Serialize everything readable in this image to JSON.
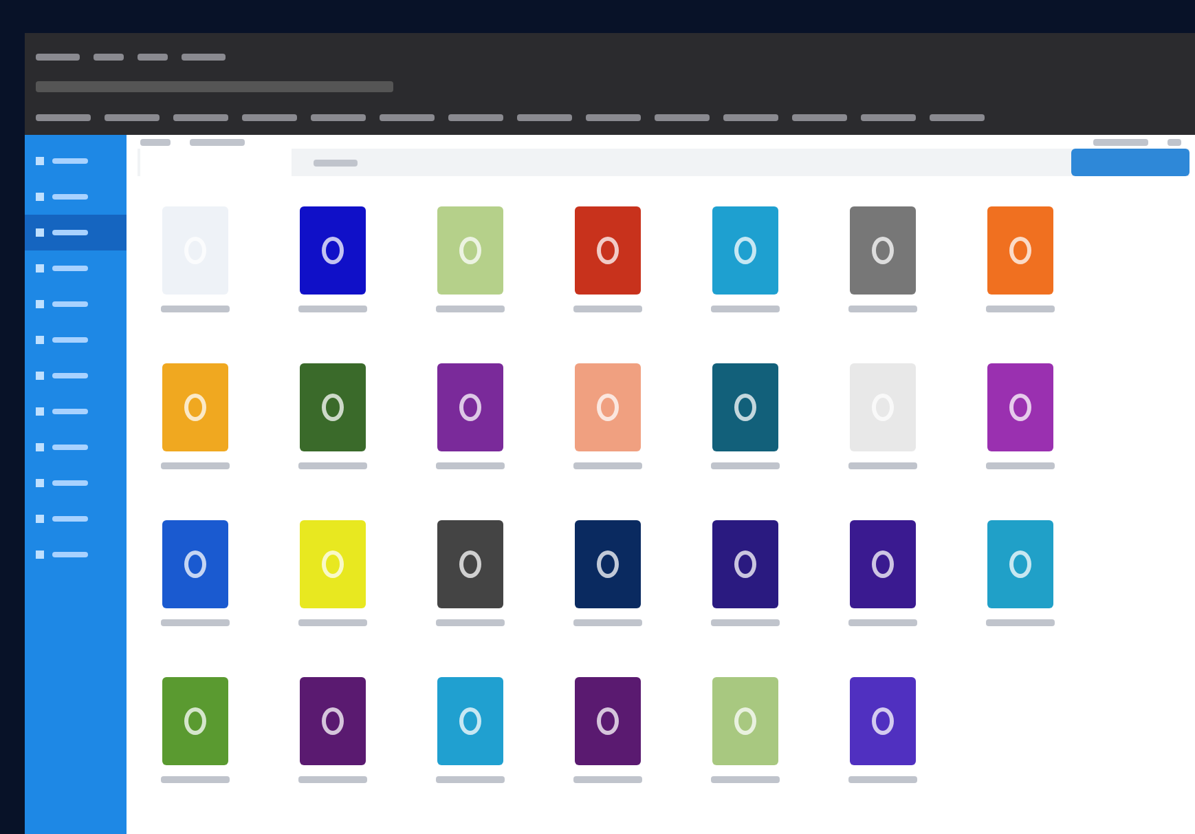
{
  "sidebar": {
    "items": [
      {
        "selected": false
      },
      {
        "selected": false
      },
      {
        "selected": true
      },
      {
        "selected": false
      },
      {
        "selected": false
      },
      {
        "selected": false
      },
      {
        "selected": false
      },
      {
        "selected": false
      },
      {
        "selected": false
      },
      {
        "selected": false
      },
      {
        "selected": false
      },
      {
        "selected": false
      }
    ]
  },
  "cards": [
    {
      "color": "#eef2f7"
    },
    {
      "color": "#1010c8"
    },
    {
      "color": "#b5d08a"
    },
    {
      "color": "#c8321c"
    },
    {
      "color": "#1ea0d0"
    },
    {
      "color": "#777777"
    },
    {
      "color": "#f07020"
    },
    {
      "color": "#f0a820"
    },
    {
      "color": "#3a6a2a"
    },
    {
      "color": "#7a2a9a"
    },
    {
      "color": "#f0a080"
    },
    {
      "color": "#12607a"
    },
    {
      "color": "#e8e8e8"
    },
    {
      "color": "#9a30b0"
    },
    {
      "color": "#1a5ad0"
    },
    {
      "color": "#e8e820"
    },
    {
      "color": "#444444"
    },
    {
      "color": "#0a2a60"
    },
    {
      "color": "#2a1a80"
    },
    {
      "color": "#3a1a90"
    },
    {
      "color": "#20a0c8"
    },
    {
      "color": "#5a9a30"
    },
    {
      "color": "#5a1a70"
    },
    {
      "color": "#20a0d0"
    },
    {
      "color": "#5a1a70"
    },
    {
      "color": "#a8c880"
    },
    {
      "color": "#5030c0"
    }
  ]
}
